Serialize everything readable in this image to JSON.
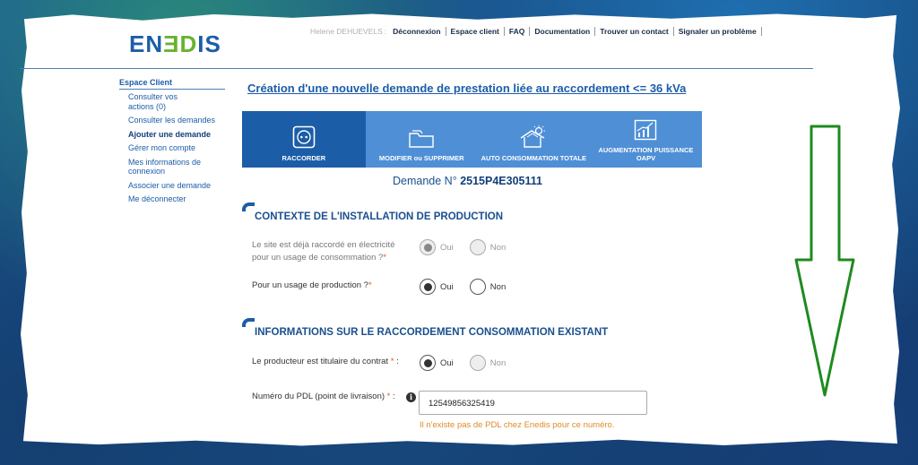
{
  "logo": {
    "text_left": "EN",
    "text_mid": "ƎD",
    "text_right": "IS"
  },
  "topnav": {
    "user": "Helene DEHUEVELS",
    "items": [
      "Déconnexion",
      "Espace client",
      "FAQ",
      "Documentation",
      "Trouver un contact",
      "Signaler un problème"
    ]
  },
  "sidebar": {
    "title": "Espace Client",
    "items": [
      "Consulter vos actions (0)",
      "Consulter les demandes",
      "Ajouter une demande",
      "Gérer mon compte",
      "Mes informations de connexion",
      "Associer une demande",
      "Me déconnecter"
    ],
    "active_index": 2
  },
  "page_title": "Création d'une nouvelle demande de prestation liée au raccordement <= 36 kVa",
  "tabs": [
    {
      "label": "RACCORDER",
      "icon": "socket-icon",
      "active": true
    },
    {
      "label": "MODIFIER ou SUPPRIMER",
      "icon": "folder-icon",
      "active": false
    },
    {
      "label": "AUTO CONSOMMATION TOTALE",
      "icon": "solar-house-icon",
      "active": false
    },
    {
      "label": "AUGMENTATION PUISSANCE OAPV",
      "icon": "chart-growth-icon",
      "active": false
    }
  ],
  "demande": {
    "prefix": "Demande N°",
    "number": "2515P4E305111"
  },
  "section1": {
    "title": "CONTEXTE DE L'INSTALLATION DE PRODUCTION",
    "q1": {
      "label": "Le site est déjà raccordé en électricité pour un usage de consommation ?",
      "req": "*",
      "oui": "Oui",
      "non": "Non",
      "selected": "Oui",
      "disabled": true
    },
    "q2": {
      "label": "Pour un usage de production ?",
      "req": "*",
      "oui": "Oui",
      "non": "Non",
      "selected": "Oui"
    }
  },
  "section2": {
    "title": "INFORMATIONS SUR LE RACCORDEMENT CONSOMMATION EXISTANT",
    "q1": {
      "label": "Le producteur est titulaire du contrat",
      "req": "*",
      "suffix": ":",
      "oui": "Oui",
      "non": "Non",
      "selected": "Oui"
    },
    "pdl": {
      "label": "Numéro du PDL (point de livraison)",
      "req": "*",
      "suffix": ":",
      "value": "12549856325419",
      "info_icon": "info-icon",
      "error": "Il n'existe pas de PDL chez Enedis pour ce numéro."
    }
  },
  "colors": {
    "brand": "#1c5da8",
    "tab_bg": "#4f8fd6",
    "arrow": "#1f8a1f",
    "error": "#e08a2a"
  }
}
